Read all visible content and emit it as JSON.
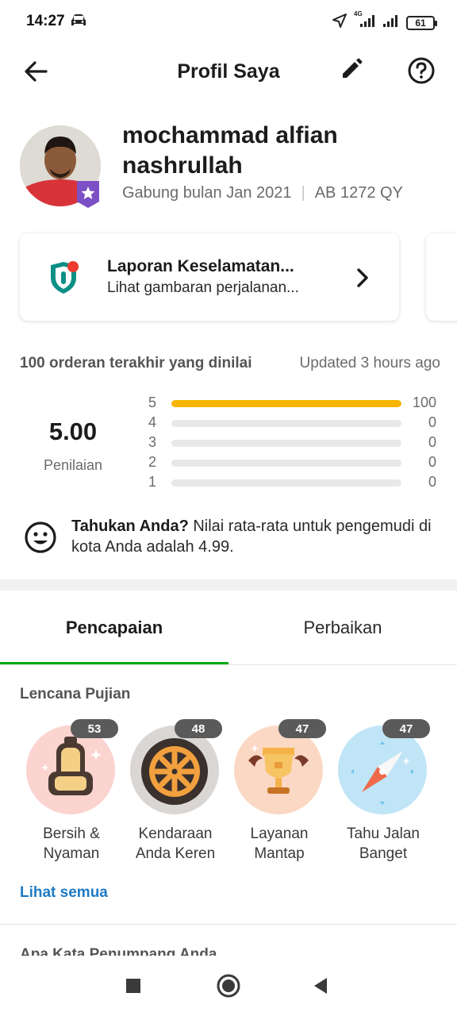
{
  "status_bar": {
    "time": "14:27",
    "network_label": "4G",
    "battery": "61"
  },
  "app_bar": {
    "title": "Profil Saya",
    "back_icon": "arrow-left-icon",
    "edit_icon": "pencil-icon",
    "help_icon": "question-circle-icon"
  },
  "profile": {
    "name": "mochammad alfian nashrullah",
    "joined": "Gabung bulan Jan 2021",
    "separator": "|",
    "plate": "AB 1272 QY"
  },
  "safety_card": {
    "title": "Laporan Keselamatan...",
    "subtitle": "Lihat gambaran perjalanan...",
    "icon": "shield-icon"
  },
  "ratings": {
    "header": "100 orderan terakhir yang dinilai",
    "updated": "Updated 3 hours ago",
    "score": "5.00",
    "score_label": "Penilaian",
    "rows": [
      {
        "star": "5",
        "count": "100",
        "fraction": 1.0
      },
      {
        "star": "4",
        "count": "0",
        "fraction": 0
      },
      {
        "star": "3",
        "count": "0",
        "fraction": 0
      },
      {
        "star": "2",
        "count": "0",
        "fraction": 0
      },
      {
        "star": "1",
        "count": "0",
        "fraction": 0
      }
    ],
    "bar_color": "#f7b500"
  },
  "fact": {
    "bold": "Tahukan Anda?",
    "text": " Nilai rata-rata untuk pengemudi di kota Anda adalah 4.99.",
    "icon": "smiley-icon"
  },
  "tabs": [
    {
      "label": "Pencapaian",
      "active": true
    },
    {
      "label": "Perbaikan",
      "active": false
    }
  ],
  "badges": {
    "title": "Lencana Pujian",
    "items": [
      {
        "label": "Bersih & Nyaman",
        "count": "53",
        "icon": "car-seat-icon",
        "color": "#fbd3cf"
      },
      {
        "label": "Kendaraan Anda Keren",
        "count": "48",
        "icon": "wheel-icon",
        "color": "#d9d6d3"
      },
      {
        "label": "Layanan Mantap",
        "count": "47",
        "icon": "trophy-icon",
        "color": "#fbd8c4"
      },
      {
        "label": "Tahu Jalan Banget",
        "count": "47",
        "icon": "compass-icon",
        "color": "#bfe5f7"
      }
    ],
    "see_all": "Lihat semua"
  },
  "next_section": "Apa Kata Penumpang Anda",
  "accent_color": "#00aa13",
  "link_color": "#1f7bc4"
}
